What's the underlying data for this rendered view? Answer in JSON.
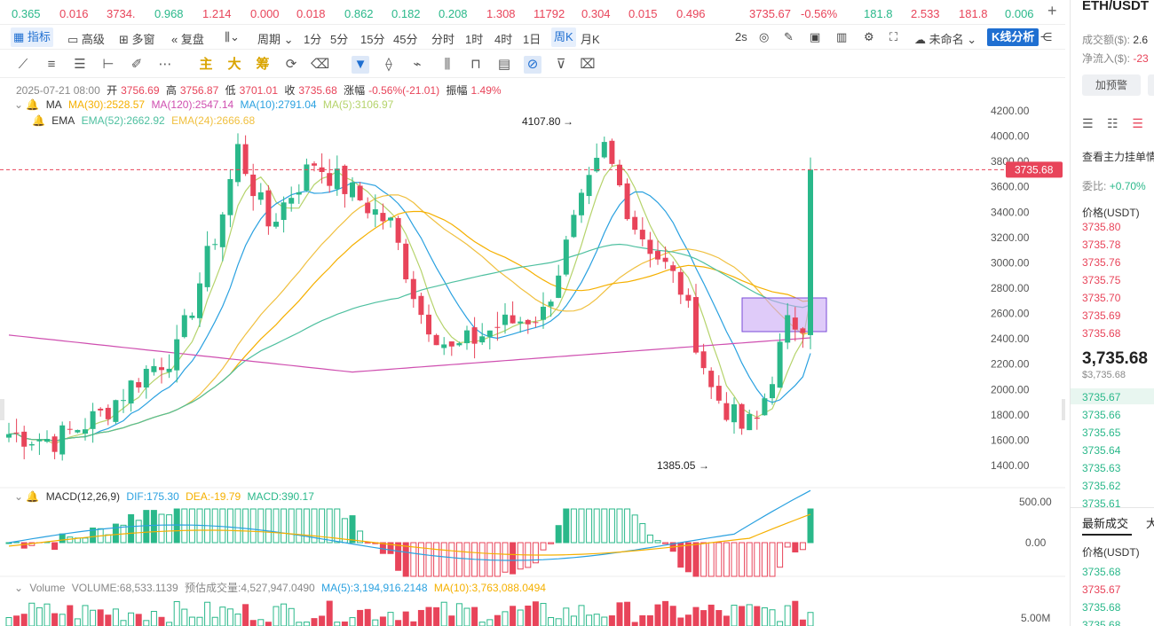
{
  "ticker": [
    {
      "value": "0.365",
      "dir": "down"
    },
    {
      "value": "0.016",
      "dir": "up"
    },
    {
      "value": "3734.",
      "dir": "up"
    },
    {
      "value": "0.968",
      "dir": "down"
    },
    {
      "value": "1.214",
      "dir": "up"
    },
    {
      "value": "0.000",
      "dir": "up"
    },
    {
      "value": "0.018",
      "dir": "up"
    },
    {
      "value": "0.862",
      "dir": "down"
    },
    {
      "value": "0.182",
      "dir": "down"
    },
    {
      "value": "0.208",
      "dir": "down"
    },
    {
      "value": "1.308",
      "dir": "up"
    },
    {
      "value": "11792",
      "dir": "up"
    },
    {
      "value": "0.304",
      "dir": "up"
    },
    {
      "value": "0.015",
      "dir": "up"
    },
    {
      "value": "0.496",
      "dir": "up"
    },
    {
      "value": "3735.67",
      "dir": "up"
    },
    {
      "value": "-0.56%",
      "dir": "up"
    },
    {
      "value": "181.8",
      "dir": "down"
    },
    {
      "value": "2.533",
      "dir": "up"
    },
    {
      "value": "181.8",
      "dir": "up"
    },
    {
      "value": "0.006",
      "dir": "down"
    }
  ],
  "toolbar": {
    "indicators": "指标",
    "advanced": "高级",
    "multi_window": "多窗",
    "replay": "复盘",
    "period": "周期",
    "periods": [
      "1分",
      "5分",
      "15分",
      "45分",
      "分时",
      "1时",
      "4时",
      "1日",
      "周K",
      "月K"
    ],
    "selected_period": "周K",
    "refresh": "2s",
    "layout_name": "未命名",
    "kline_analysis": "K线分析"
  },
  "draw_tools": {
    "main": "主",
    "big": "大",
    "chips": "筹"
  },
  "legend": {
    "candle": {
      "date": "2025-07-21 08:00",
      "open_label": "开",
      "open": "3756.69",
      "high_label": "高",
      "high": "3756.87",
      "low_label": "低",
      "low": "3701.01",
      "close_label": "收",
      "close": "3735.68",
      "change_label": "涨幅",
      "change": "-0.56%(-21.01)",
      "amp_label": "振幅",
      "amp": "1.49%"
    },
    "ma": {
      "name": "MA",
      "ma30": "MA(30):2528.57",
      "ma120": "MA(120):2547.14",
      "ma10": "MA(10):2791.04",
      "ma5": "MA(5):3106.97"
    },
    "ema": {
      "name": "EMA",
      "ema52": "EMA(52):2662.92",
      "ema24": "EMA(24):2666.68"
    },
    "macd": {
      "name": "MACD(12,26,9)",
      "dif": "DIF:175.30",
      "dea": "DEA:-19.79",
      "macd": "MACD:390.17"
    },
    "volume": {
      "name": "Volume",
      "volume": "VOLUME:68,533.1139",
      "est": "预估成交量:4,527,947.0490",
      "ma5": "MA(5):3,194,916.2148",
      "ma10": "MA(10):3,763,088.0494"
    }
  },
  "price_axis": [
    "4200.00",
    "4000.00",
    "3800.00",
    "3600.00",
    "3400.00",
    "3200.00",
    "3000.00",
    "2800.00",
    "2600.00",
    "2400.00",
    "2200.00",
    "2000.00",
    "1800.00",
    "1600.00",
    "1400.00"
  ],
  "current_price_tag": "3735.68",
  "high_annotation": "4107.80",
  "low_annotation": "1385.05",
  "macd_axis": [
    "500.00",
    "0.00"
  ],
  "volume_axis": [
    "5.00M"
  ],
  "colors": {
    "up": "#2ab88a",
    "down": "#e8445a",
    "ma5": "#b5d36b",
    "ma10": "#2aa1e0",
    "ma30": "#f5b000",
    "ma120": "#cf4fb0",
    "ema52": "#4fc0a0",
    "ema24": "#f0c040",
    "box": "#c9a8f5"
  },
  "right_panel": {
    "symbol": "ETH/USDT",
    "turnover_label": "成交额($):",
    "turnover_value": "2.6",
    "netflow_label": "净流入($):",
    "netflow_value": "-23",
    "alert_button": "加预警",
    "orderbook_title": "查看主力挂单情",
    "ratio_label": "委比:",
    "ratio_value": "+0.70%",
    "price_header": "价格(USDT)",
    "asks": [
      "3735.80",
      "3735.78",
      "3735.76",
      "3735.75",
      "3735.70",
      "3735.69",
      "3735.68"
    ],
    "last_price": "3,735.68",
    "last_price_usd": "$3,735.68",
    "bids": [
      "3735.67",
      "3735.66",
      "3735.65",
      "3735.64",
      "3735.63",
      "3735.62",
      "3735.61"
    ],
    "trades_tab": "最新成交",
    "trades_tab2": "大",
    "trades_price_header": "价格(USDT)",
    "trades": [
      {
        "price": "3735.68",
        "dir": "up"
      },
      {
        "price": "3735.67",
        "dir": "down"
      },
      {
        "price": "3735.68",
        "dir": "up"
      },
      {
        "price": "3735.68",
        "dir": "up"
      }
    ]
  }
}
